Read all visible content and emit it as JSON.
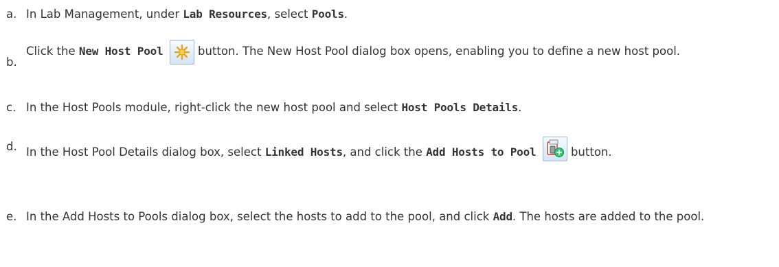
{
  "steps": [
    {
      "marker": "a.",
      "parts": [
        "In Lab Management, under ",
        "Lab Resources",
        ", select ",
        "Pools",
        "."
      ]
    },
    {
      "marker": "b.",
      "parts": [
        "Click the ",
        "New Host Pool",
        " button. The New Host Pool dialog box opens, enabling you to define a new host pool."
      ],
      "icon": "new-host-pool-icon"
    },
    {
      "marker": "c.",
      "parts": [
        "In the Host Pools module, right-click the new host pool and select ",
        "Host Pools Details",
        "."
      ]
    },
    {
      "marker": "d.",
      "parts": [
        "In the Host Pool Details dialog box, select ",
        "Linked Hosts",
        ", and click the ",
        "Add Hosts to Pool",
        " button."
      ],
      "icon": "add-hosts-to-pool-icon"
    },
    {
      "marker": "e.",
      "parts": [
        "In the Add Hosts to Pools dialog box, select the hosts to add to the pool, and click ",
        "Add",
        ". The hosts are added to the pool."
      ]
    }
  ]
}
